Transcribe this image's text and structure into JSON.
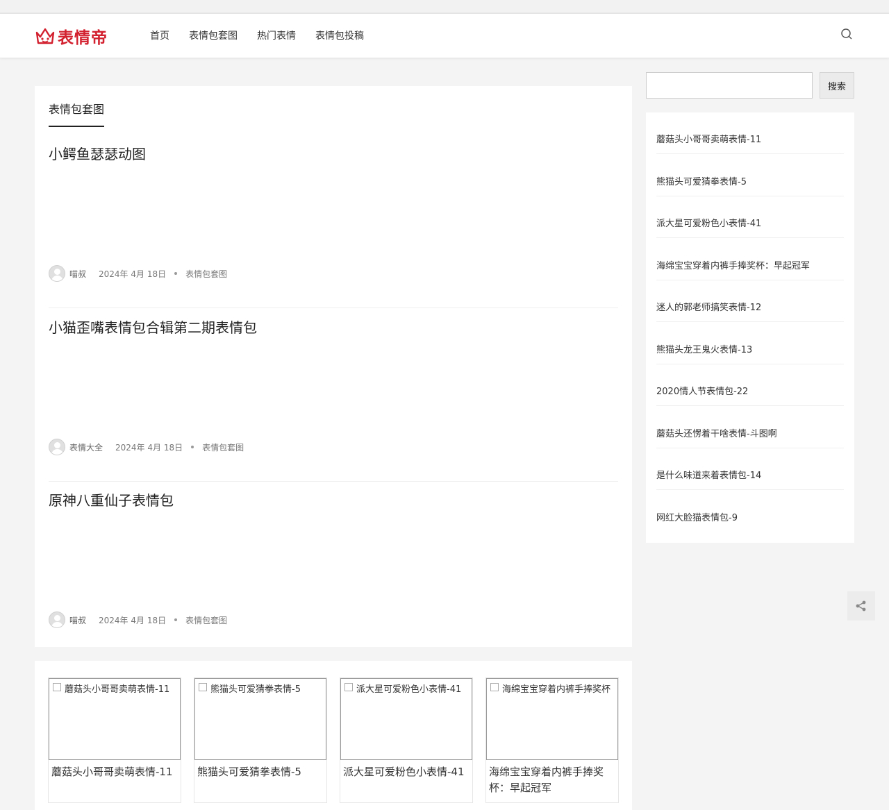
{
  "site": {
    "logo_text": "表情帝",
    "brand_color": "#d3202e"
  },
  "nav": {
    "items": [
      "首页",
      "表情包套图",
      "热门表情",
      "表情包投稿"
    ]
  },
  "main": {
    "section_tab": "表情包套图",
    "posts": [
      {
        "title": "小鳄鱼瑟瑟动图",
        "author": "喵叔",
        "date": "2024年 4月 18日",
        "category": "表情包套图"
      },
      {
        "title": "小猫歪嘴表情包合辑第二期表情包",
        "author": "表情大全",
        "date": "2024年 4月 18日",
        "category": "表情包套图"
      },
      {
        "title": "原神八重仙子表情包",
        "author": "喵叔",
        "date": "2024年 4月 18日",
        "category": "表情包套图"
      }
    ]
  },
  "related": [
    {
      "alt": "蘑菇头小哥哥卖萌表情-11",
      "title": "蘑菇头小哥哥卖萌表情-11"
    },
    {
      "alt": "熊猫头可爱猜拳表情-5",
      "title": "熊猫头可爱猜拳表情-5"
    },
    {
      "alt": "派大星可爱粉色小表情-41",
      "title": "派大星可爱粉色小表情-41"
    },
    {
      "alt": "海绵宝宝穿着内裤手捧奖杯",
      "title": "海绵宝宝穿着内裤手捧奖杯：早起冠军"
    }
  ],
  "sidebar": {
    "search_placeholder": "",
    "search_button": "搜索",
    "items": [
      "蘑菇头小哥哥卖萌表情-11",
      "熊猫头可爱猜拳表情-5",
      "派大星可爱粉色小表情-41",
      "海绵宝宝穿着内裤手捧奖杯：早起冠军",
      "迷人的郭老师搞笑表情-12",
      "熊猫头龙王鬼火表情-13",
      "2020情人节表情包-22",
      "蘑菇头还愣着干啥表情-斗图啊",
      "是什么味道来着表情包-14",
      "网红大脸猫表情包-9"
    ]
  },
  "icons": {
    "search": "search-icon",
    "share": "share-icon",
    "crown": "crown-icon"
  }
}
